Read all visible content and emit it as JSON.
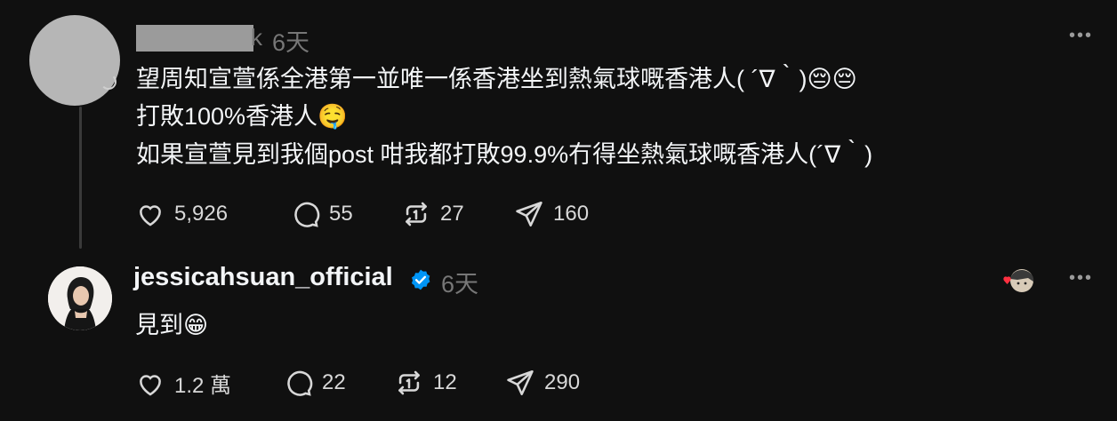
{
  "post": {
    "time": "6天",
    "redacted_tail": "k",
    "lines": [
      "望周知宣萱係全港第一並唯一係香港坐到熱氣球嘅香港人( ´∇｀)😔😔",
      "打敗100%香港人🤤",
      "如果宣萱見到我個post 咁我都打敗99.9%冇得坐熱氣球嘅香港人(´∇｀)"
    ],
    "stats": {
      "likes": "5,926",
      "comments": "55",
      "reposts": "27",
      "shares": "160"
    }
  },
  "reply": {
    "username": "jessicahsuan_official",
    "time": "6天",
    "text": "見到😁",
    "stats": {
      "likes": "1.2 萬",
      "comments": "22",
      "reposts": "12",
      "shares": "290"
    }
  },
  "icons": {
    "like": "heart-outline-icon",
    "comment": "speech-bubble-icon",
    "repost": "repost-arrows-icon",
    "share": "paper-plane-icon",
    "verified": "verified-badge-icon",
    "more": "more-dots-icon"
  },
  "colors": {
    "background": "#101010",
    "text": "#f3f5f7",
    "muted": "#777777",
    "verified": "#0095f6",
    "heart": "#ff3040"
  }
}
